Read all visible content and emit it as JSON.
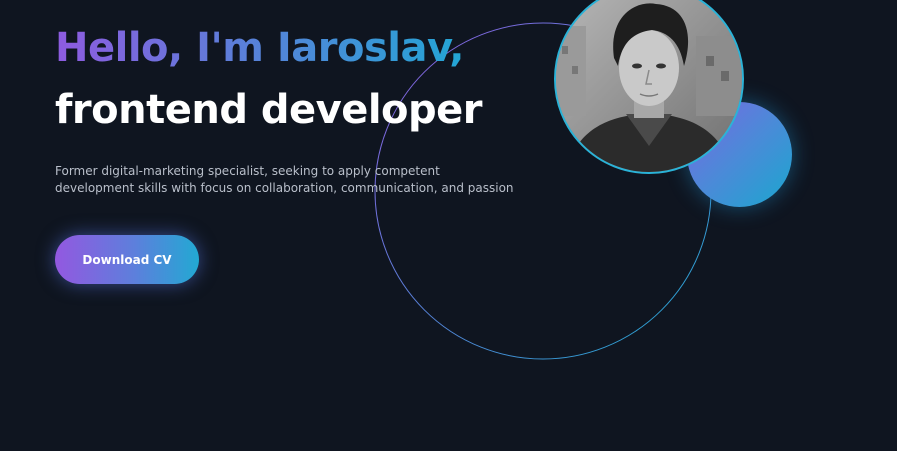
{
  "hero": {
    "greeting": "Hello, I'm Iaroslav,",
    "role": "frontend developer",
    "bio": "Former digital-marketing specialist, seeking to apply competent development skills with focus on collaboration, communication, and passion",
    "download_label": "Download CV"
  },
  "colors": {
    "background": "#0f1520",
    "gradient_start": "#9358e0",
    "gradient_end": "#22a9d3",
    "heading_white": "#ffffff",
    "body_text": "#b9bfca"
  }
}
